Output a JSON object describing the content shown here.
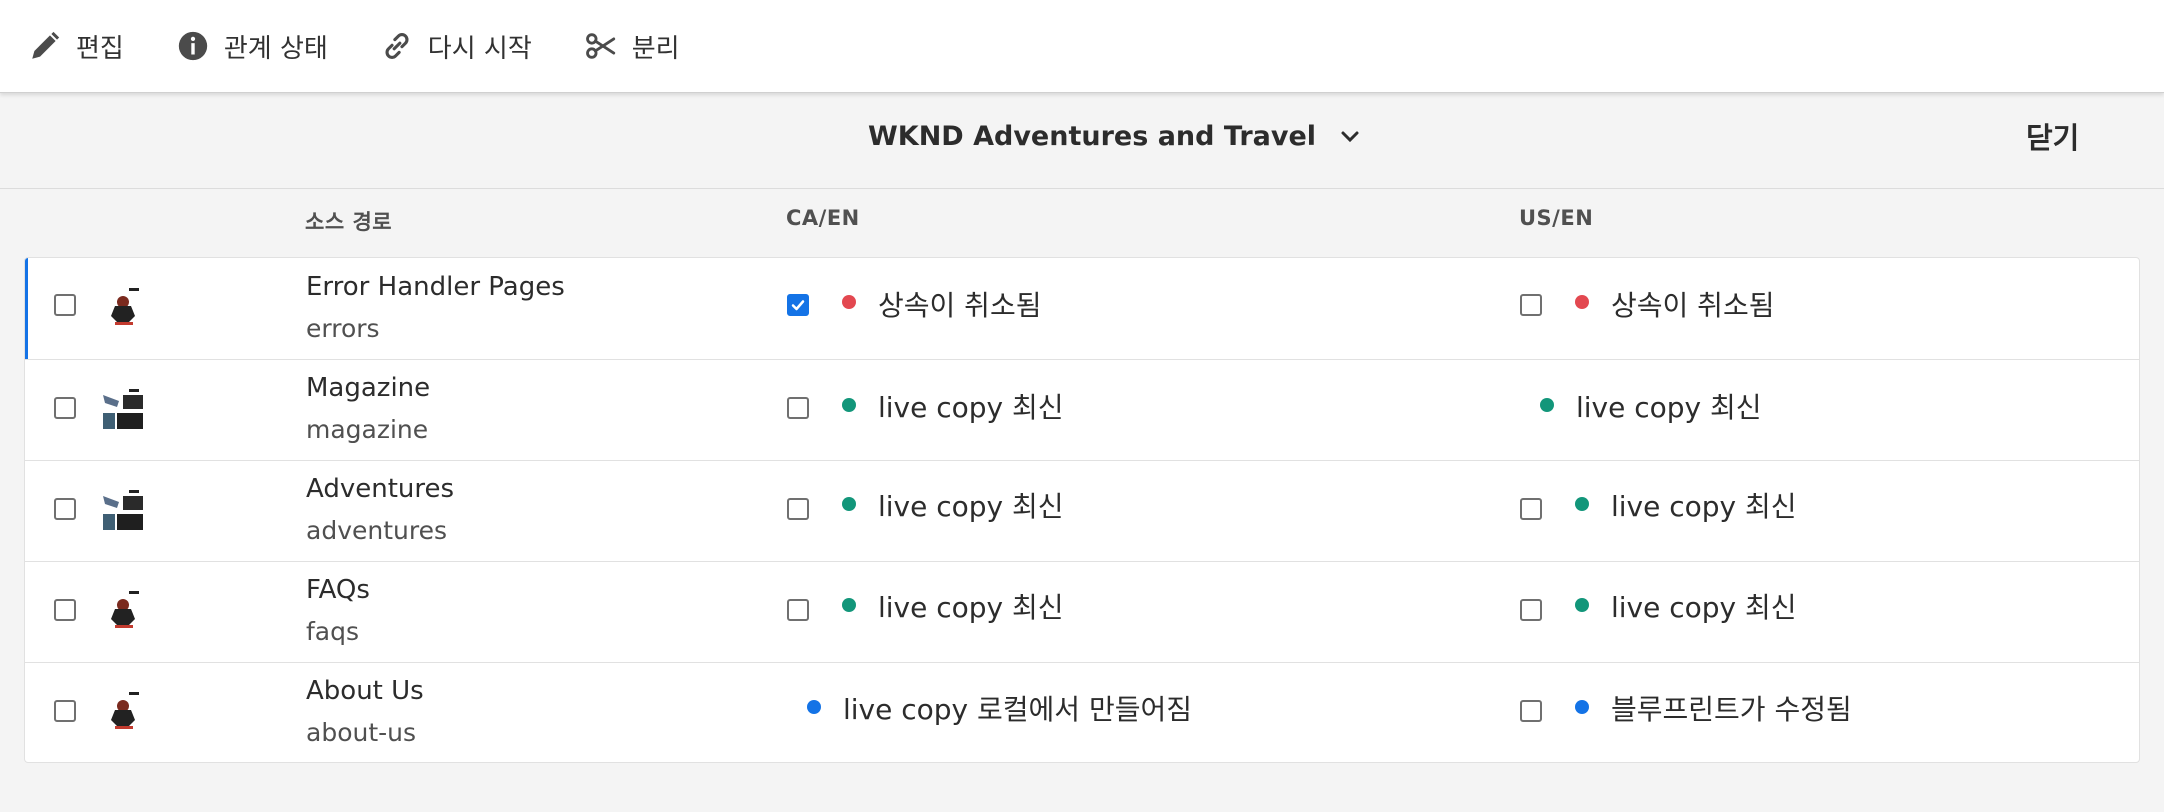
{
  "toolbar": {
    "edit_label": "편집",
    "relation_status_label": "관계 상태",
    "resume_label": "다시 시작",
    "detach_label": "분리"
  },
  "header": {
    "site_title": "WKND Adventures and Travel",
    "close_label": "닫기"
  },
  "columns": {
    "source_path": "소스 경로",
    "col_a": "CA/EN",
    "col_b": "US/EN"
  },
  "colors": {
    "red": "#e34850",
    "green": "#12967a",
    "blue": "#1473e6"
  },
  "rows": [
    {
      "title": "Error Handler Pages",
      "path": "errors",
      "selected": true,
      "a": {
        "checkbox": true,
        "checked": true,
        "dot": "red",
        "status": "상속이 취소됨"
      },
      "b": {
        "checkbox": true,
        "checked": false,
        "dot": "red",
        "status": "상속이 취소됨"
      }
    },
    {
      "title": "Magazine",
      "path": "magazine",
      "selected": false,
      "a": {
        "checkbox": true,
        "checked": false,
        "dot": "green",
        "status": "live copy 최신"
      },
      "b": {
        "checkbox": false,
        "checked": false,
        "dot": "green",
        "status": "live copy 최신"
      }
    },
    {
      "title": "Adventures",
      "path": "adventures",
      "selected": false,
      "a": {
        "checkbox": true,
        "checked": false,
        "dot": "green",
        "status": "live copy 최신"
      },
      "b": {
        "checkbox": true,
        "checked": false,
        "dot": "green",
        "status": "live copy 최신"
      }
    },
    {
      "title": "FAQs",
      "path": "faqs",
      "selected": false,
      "a": {
        "checkbox": true,
        "checked": false,
        "dot": "green",
        "status": "live copy 최신"
      },
      "b": {
        "checkbox": true,
        "checked": false,
        "dot": "green",
        "status": "live copy 최신"
      }
    },
    {
      "title": "About Us",
      "path": "about-us",
      "selected": false,
      "a": {
        "checkbox": false,
        "checked": false,
        "dot": "blue",
        "status": "live copy 로컬에서 만들어짐"
      },
      "b": {
        "checkbox": true,
        "checked": false,
        "dot": "blue",
        "status": "블루프린트가 수정됨"
      }
    }
  ]
}
